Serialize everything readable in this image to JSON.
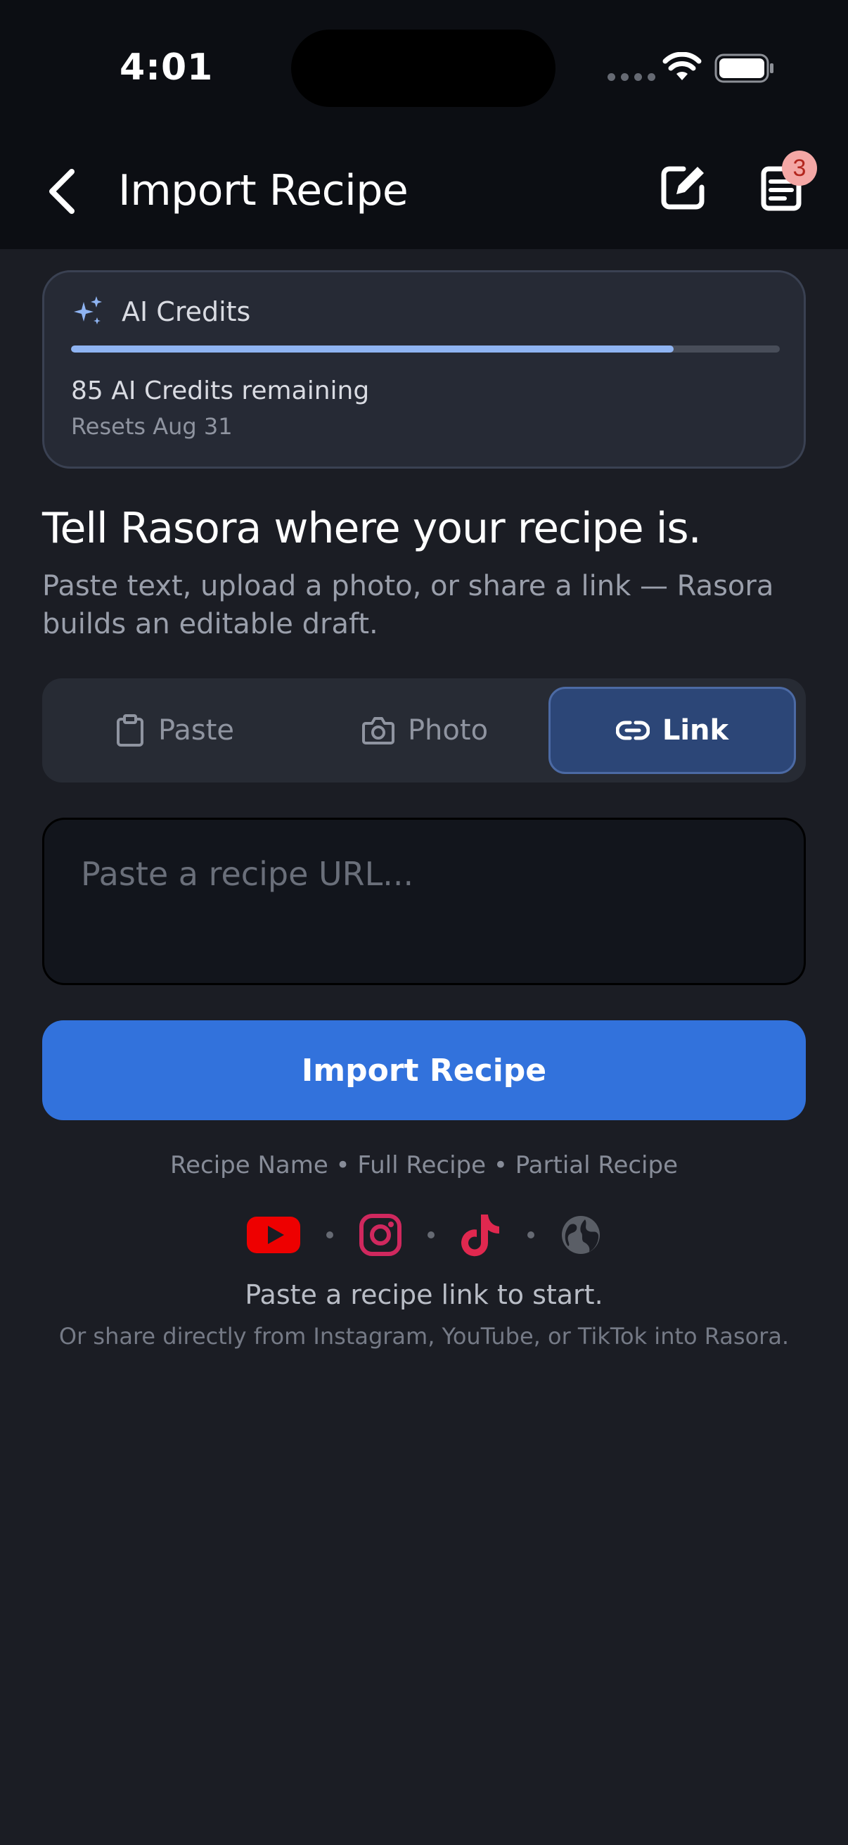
{
  "status_bar": {
    "time": "4:01"
  },
  "nav": {
    "title": "Import Recipe",
    "badge_count": "3"
  },
  "credits": {
    "title": "AI Credits",
    "remaining_text": "85 AI Credits remaining",
    "reset_text": "Resets Aug 31",
    "progress_fraction": 0.85,
    "accent": "#8fb4f2"
  },
  "main": {
    "headline": "Tell Rasora where your recipe is.",
    "subtitle": "Paste text, upload a photo, or share a link — Rasora builds an editable draft."
  },
  "tabs": [
    {
      "label": "Paste",
      "icon": "clipboard-icon",
      "selected": false
    },
    {
      "label": "Photo",
      "icon": "camera-icon",
      "selected": false
    },
    {
      "label": "Link",
      "icon": "link-icon",
      "selected": true
    }
  ],
  "input": {
    "placeholder": "Paste a recipe URL...",
    "value": ""
  },
  "import_button": {
    "label": "Import Recipe",
    "color": "#3272dc"
  },
  "recipe_types": "Recipe Name • Full Recipe • Partial Recipe",
  "sources": [
    {
      "icon": "youtube-icon",
      "color": "#ee0000"
    },
    {
      "icon": "instagram-icon",
      "color": "#d0285e"
    },
    {
      "icon": "tiktok-icon",
      "color": "#e0284f"
    },
    {
      "icon": "globe-icon",
      "color": "#5a5e66"
    }
  ],
  "hint": {
    "primary": "Paste a recipe link to start.",
    "secondary": "Or share directly from Instagram, YouTube, or TikTok into Rasora."
  }
}
